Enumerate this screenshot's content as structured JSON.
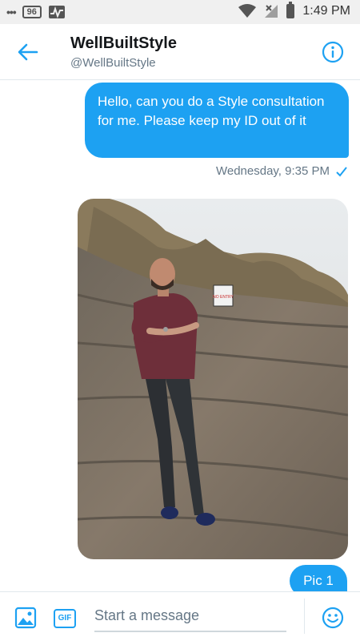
{
  "status_bar": {
    "time": "1:49 PM",
    "notification_badge": "96",
    "icons": [
      "dots-icon",
      "message-badge-icon",
      "activity-icon",
      "wifi-icon",
      "no-signal-icon",
      "battery-icon"
    ]
  },
  "header": {
    "name": "WellBuiltStyle",
    "handle": "@WellBuiltStyle",
    "icons": [
      "back-arrow-icon",
      "info-icon"
    ]
  },
  "messages": [
    {
      "text": "Hello, can you do a Style consultation for me. Please keep my ID out of it",
      "timestamp": "Wednesday, 9:35 PM",
      "status_icon": "checkmark-icon"
    },
    {
      "type": "image",
      "sign_text": "NO ENTRY"
    },
    {
      "text": "Pic 1"
    }
  ],
  "composer": {
    "placeholder": "Start a message",
    "gif_label": "GIF",
    "icons": [
      "image-icon",
      "gif-icon",
      "emoji-icon"
    ]
  },
  "colors": {
    "accent": "#1da1f2",
    "bubble_text": "#ffffff",
    "secondary_text": "#657786"
  }
}
